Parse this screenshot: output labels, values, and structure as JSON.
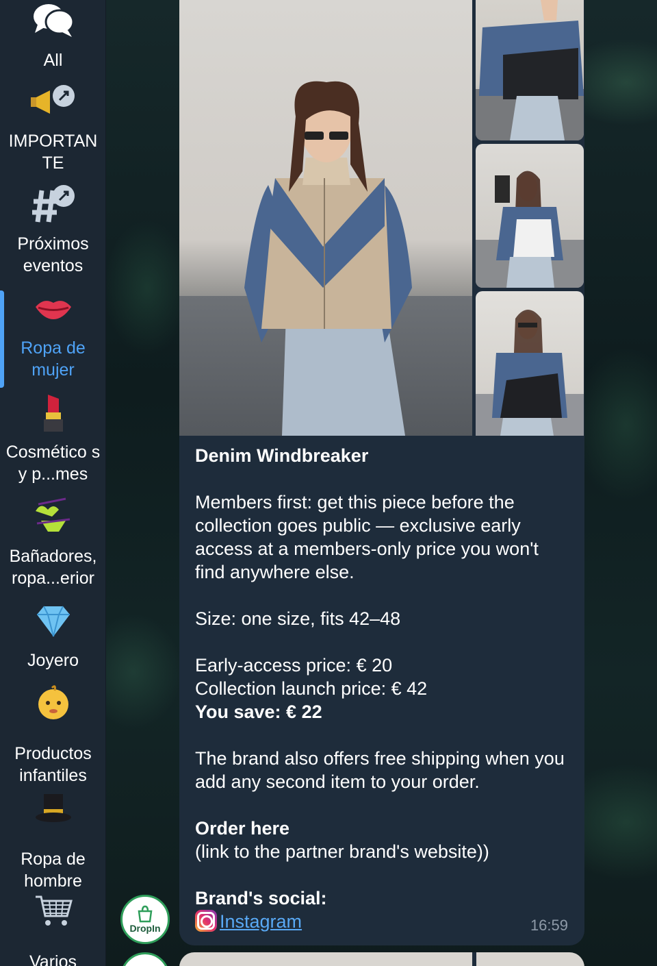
{
  "sidebar": {
    "folders": [
      {
        "label": "All",
        "icon": "chat-bubbles-icon",
        "glyph": "💬"
      },
      {
        "label": "IMPORTAN TE",
        "icon": "megaphone-pin-icon",
        "glyph": "📢"
      },
      {
        "label": "Próximos eventos",
        "icon": "hashtag-pin-icon",
        "glyph": "#"
      },
      {
        "label": "Ropa de mujer",
        "icon": "lips-icon",
        "glyph": "👄"
      },
      {
        "label": "Cosmético s y p...mes",
        "icon": "lipstick-icon",
        "glyph": "💄"
      },
      {
        "label": "Bañadores, ropa...erior",
        "icon": "bikini-icon",
        "glyph": "👙"
      },
      {
        "label": "Joyero",
        "icon": "gem-icon",
        "glyph": "💎"
      },
      {
        "label": "Productos infantiles",
        "icon": "baby-icon",
        "glyph": "👶"
      },
      {
        "label": "Ropa de hombre",
        "icon": "top-hat-icon",
        "glyph": "🎩"
      },
      {
        "label": "Varios",
        "icon": "shopping-cart-icon",
        "glyph": "🛒"
      }
    ],
    "active_index": 3,
    "active_color": "#4fa3f7"
  },
  "message": {
    "title": "Denim Windbreaker",
    "intro": "Members first: get this piece before the collection goes public — exclusive early access at a members-only price you won't find anywhere else.",
    "size": "Size: one size, fits 42–48",
    "early_price": "Early-access price: € 20",
    "launch_price": "Collection launch price: € 42",
    "save": "You save: € 22",
    "shipping": "The brand also offers free shipping when you add any second item to your order.",
    "order_title": "Order here",
    "order_link": "(link to the partner brand's website))",
    "social_title": "Brand's social:",
    "instagram": "Instagram",
    "time": "16:59"
  },
  "avatar": {
    "label": "DropIn"
  }
}
